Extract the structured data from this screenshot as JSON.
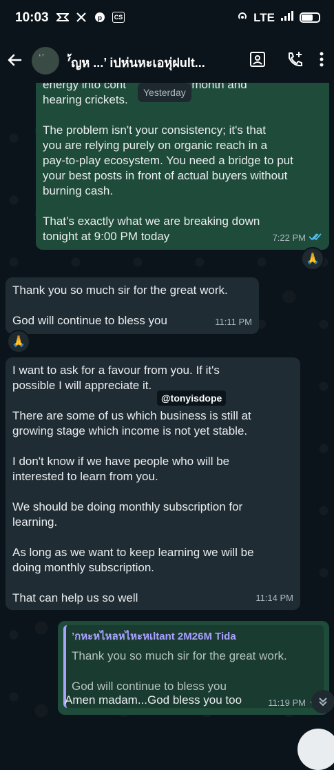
{
  "status_bar": {
    "time": "10:03",
    "network": "LTE",
    "left_icons": [
      "chat-bubble-icon",
      "x-icon",
      "pinterest-icon",
      "cs-icon"
    ],
    "right_icons": [
      "hotspot-icon",
      "signal-icon",
      "battery-icon"
    ]
  },
  "header": {
    "avatar_glyph": "‘’",
    "title": "’้ญห ...’ iปห่นหะเอหุ่ฝult...",
    "icons": [
      "back-arrow-icon",
      "contact-card-icon",
      "add-call-icon",
      "more-vert-icon"
    ]
  },
  "chat": {
    "date_pill": "Yesterday",
    "watermark": "@tonyisdope",
    "messages": [
      {
        "direction": "out",
        "text": "energy into cont            after month and\nhearing crickets.\n\nThe problem isn't your consistency; it's that\nyou are relying purely on organic reach in a\npay-to-play ecosystem. You need a bridge to put\nyour best posts in front of actual buyers without\nburning cash.\n\nThat’s exactly what we are breaking down\ntonight at 9:00 PM today",
        "time": "7:22 PM",
        "read": true,
        "reaction": "🙏"
      },
      {
        "direction": "in",
        "text": "Thank you so much sir for the great work.\n\nGod will continue to bless you",
        "time": "11:11 PM",
        "reaction": "🙏"
      },
      {
        "direction": "in",
        "text": "I want to ask for a favour from you. If it's\npossible I will appreciate it.\n\nThere are some of us which business is still at\ngrowing stage which income is not yet stable.\n\nI don't know if we have people who will be\ninterested to learn from you.\n\nWe should be doing monthly subscription for\nlearning.\n\nAs long as we want to keep learning we will be\ndoing monthly subscription.\n\nThat can help us so well",
        "time": "11:14 PM"
      },
      {
        "direction": "out",
        "quote_author": "’กหะหไหลหไหะหเltant 2M26M Tida",
        "quote_text": "Thank you so much sir for the great work.\n\nGod will continue to bless you",
        "text": "Amen madam...God bless you too",
        "time": "11:19 PM",
        "read": false
      }
    ]
  },
  "colors": {
    "background": "#0b141a",
    "outgoing_bubble": "#1f4b3a",
    "incoming_bubble": "#202c33",
    "read_ticks": "#53bdeb",
    "quote_accent": "#a8a2ff"
  }
}
